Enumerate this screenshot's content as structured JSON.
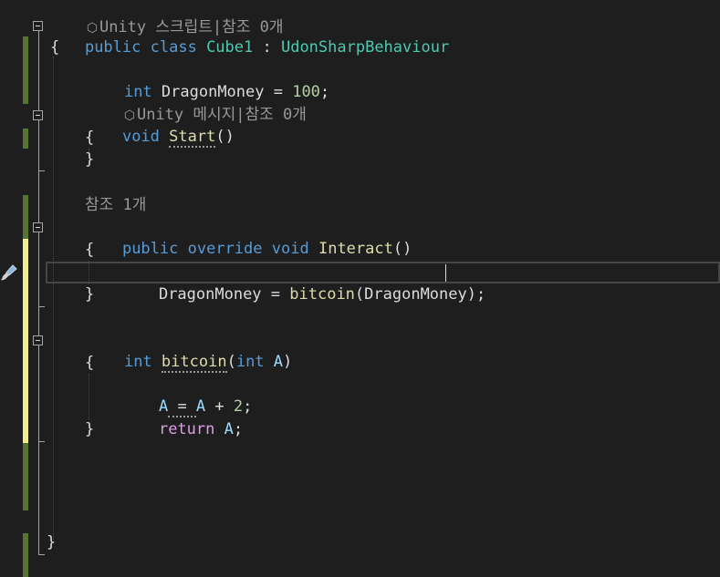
{
  "lens_top": {
    "icon": "unity-cube-icon",
    "text": "Unity 스크립트|참조 0개"
  },
  "class_decl": {
    "kw1": "public",
    "kw2": "class",
    "name": "Cube1",
    "sep": " : ",
    "base": "UdonSharpBehaviour"
  },
  "open_brace_1": "{",
  "field": {
    "type": "int",
    "name": " DragonMoney = ",
    "value": "100",
    "end": ";"
  },
  "lens_start": {
    "icon": "unity-cube-icon",
    "text": "Unity 메시지|참조 0개"
  },
  "start_decl": {
    "kw": "void",
    "name": "Start",
    "parens": "()"
  },
  "brace_open_start": "{",
  "brace_close_start": "}",
  "lens_interact": "참조 1개",
  "interact_decl": {
    "kw1": "public",
    "kw2": "override",
    "kw3": "void",
    "name": "Interact",
    "parens": "()"
  },
  "brace_open_interact": "{",
  "interact_body": {
    "var": "DragonMoney",
    "eq": " = ",
    "call": "bitcoin",
    "args": "(DragonMoney);"
  },
  "brace_close_interact": "}",
  "bitcoin_decl": {
    "kw": "int",
    "name": "bitcoin",
    "open": "(",
    "param_type": "int",
    "param": "A",
    "close": ")"
  },
  "brace_open_bitcoin": "{",
  "assign": {
    "var": "A",
    "eq": " = ",
    "rhs": "A",
    "rest": " + ",
    "num": "2",
    "end": ";"
  },
  "return_stmt": {
    "kw": "return",
    "var": " A",
    "end": ";"
  },
  "brace_close_bitcoin": "}",
  "close_brace_1": "}",
  "colors": {
    "keyword": "#569cd6",
    "type": "#4ec9b0",
    "method": "#dcdcaa",
    "number": "#b5cea8",
    "control": "#d8a0df",
    "background": "#1e1e1e"
  }
}
